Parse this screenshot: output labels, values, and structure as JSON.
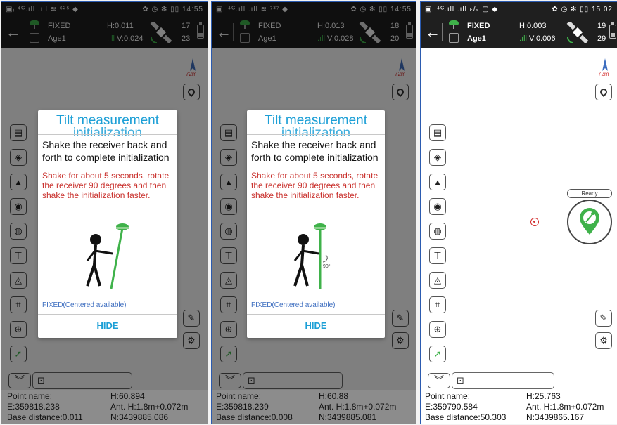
{
  "panels": [
    {
      "status_left": "▣ᵢ ⁴ᴳ.ıll .ıll ≋ ⁶²⁵ ◆",
      "status_right": "✿ ◷ ✻ ▯▯ 14:55",
      "toolbar": {
        "fix": "FIXED",
        "age": "Age1",
        "h": "H:0.011",
        "v": "V:0.024",
        "sats_top": "17",
        "sats_bottom": "23"
      },
      "scale": "72m",
      "dialog": {
        "title": "Tilt measurement",
        "title_overflow": "initialization",
        "main": "Shake the receiver back and forth to complete initialization",
        "warn": "Shake for about 5 seconds, rotate the receiver 90 degrees and then shake the initialization faster.",
        "status": "FIXED(Centered available)",
        "hide": "HIDE"
      },
      "info": {
        "point_label": "Point name:",
        "h": "H:60.894",
        "e": "E:359818.238",
        "ant": "Ant. H:1.8m+0.072m",
        "base": "Base distance:0.011",
        "n": "N:3439885.086"
      }
    },
    {
      "status_left": "▣ᵢ ⁴ᴳ.ıll .ıll ≋ ⁷³⁷ ◆",
      "status_right": "✿ ◷ ✻ ▯▯ 14:55",
      "toolbar": {
        "fix": "FIXED",
        "age": "Age1",
        "h": "H:0.013",
        "v": "V:0.028",
        "sats_top": "18",
        "sats_bottom": "20"
      },
      "scale": "72m",
      "dialog": {
        "title": "Tilt measurement",
        "title_overflow": "initialization",
        "main": "Shake the receiver back and forth to complete initialization",
        "warn": "Shake for about 5 seconds, rotate the receiver 90 degrees and then shake the initialization faster.",
        "angle": "90°",
        "status": "FIXED(Centered available)",
        "hide": "HIDE"
      },
      "info": {
        "point_label": "Point name:",
        "h": "H:60.88",
        "e": "E:359818.239",
        "ant": "Ant. H:1.8m+0.072m",
        "base": "Base distance:0.008",
        "n": "N:3439885.081"
      }
    },
    {
      "status_left": "▣ᵢ ⁴ᴳ.ıll .ıll ₖ/ₛ ▢ ◆",
      "status_right": "✿ ◷ ✻ ▯▯ 15:02",
      "toolbar": {
        "fix": "FIXED",
        "age": "Age1",
        "h": "H:0.003",
        "v": "V:0.006",
        "sats_top": "19",
        "sats_bottom": "29"
      },
      "scale": "72m",
      "ready": "Ready",
      "info": {
        "point_label": "Point name:",
        "h": "H:25.763",
        "e": "E:359790.584",
        "ant": "Ant. H:1.8m+0.072m",
        "base": "Base distance:50.303",
        "n": "N:3439865.167"
      }
    }
  ],
  "colors": {
    "accent": "#1c9fd6",
    "warning": "#c9302c",
    "fix_green": "#3fb24a",
    "status_blue": "#3f6fc0"
  }
}
